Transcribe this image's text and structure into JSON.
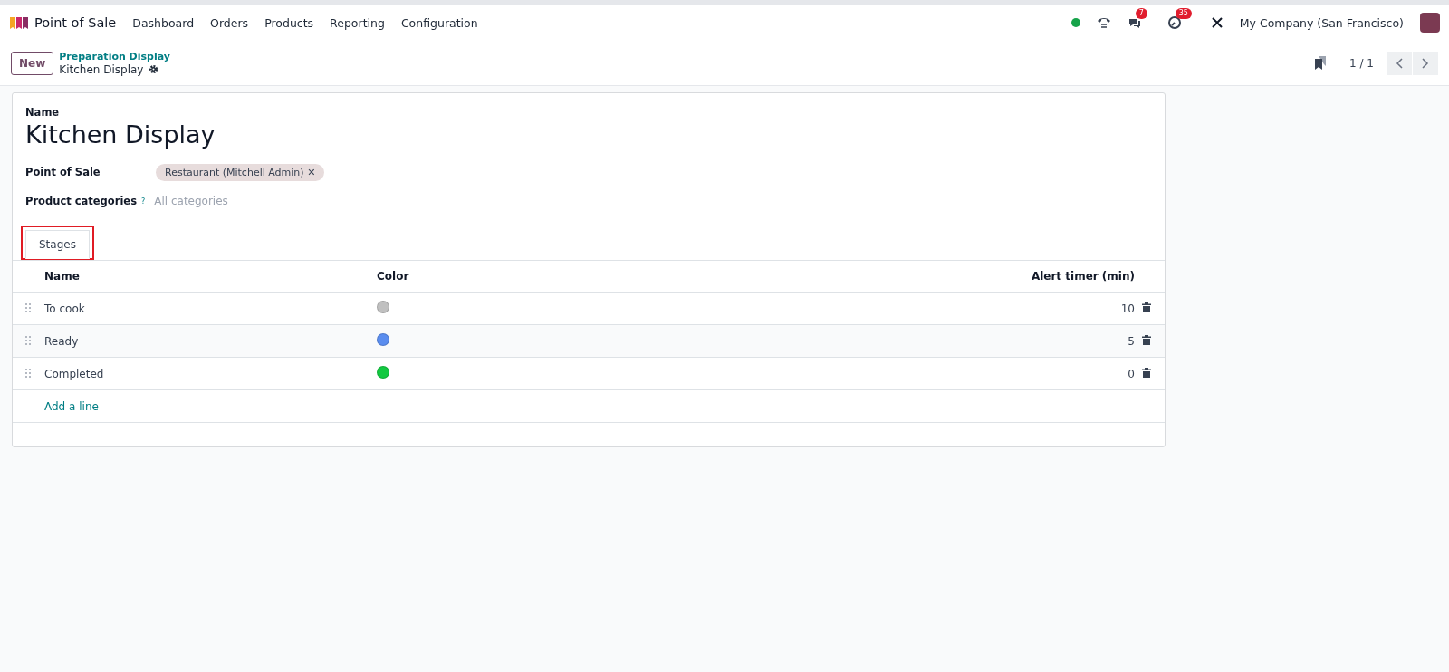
{
  "navbar": {
    "app_name": "Point of Sale",
    "menu": [
      "Dashboard",
      "Orders",
      "Products",
      "Reporting",
      "Configuration"
    ],
    "messages_badge": "7",
    "activities_badge": "35",
    "company": "My Company (San Francisco)"
  },
  "control_panel": {
    "new_button": "New",
    "breadcrumb_parent": "Preparation Display",
    "breadcrumb_current": "Kitchen Display",
    "pager": "1 / 1"
  },
  "form": {
    "name_label": "Name",
    "name_value": "Kitchen Display",
    "fields": [
      {
        "label": "Point of Sale",
        "kind": "tags",
        "tags": [
          {
            "label": "Restaurant (Mitchell Admin)",
            "remove": "✕"
          }
        ]
      },
      {
        "label": "Product categories",
        "help_mark": "?",
        "kind": "text",
        "placeholder": "All categories"
      }
    ],
    "tabs": [
      {
        "label": "Stages",
        "selected": true,
        "highlighted": true
      }
    ],
    "table": {
      "columns": [
        "Name",
        "Color",
        "Alert timer (min)"
      ],
      "rows": [
        {
          "name": "To cook",
          "color": "#c0c0c0",
          "alert_timer": "10"
        },
        {
          "name": "Ready",
          "color": "#5b8def",
          "alert_timer": "5"
        },
        {
          "name": "Completed",
          "color": "#12c940",
          "alert_timer": "0"
        }
      ],
      "add_line": "Add a line"
    }
  }
}
